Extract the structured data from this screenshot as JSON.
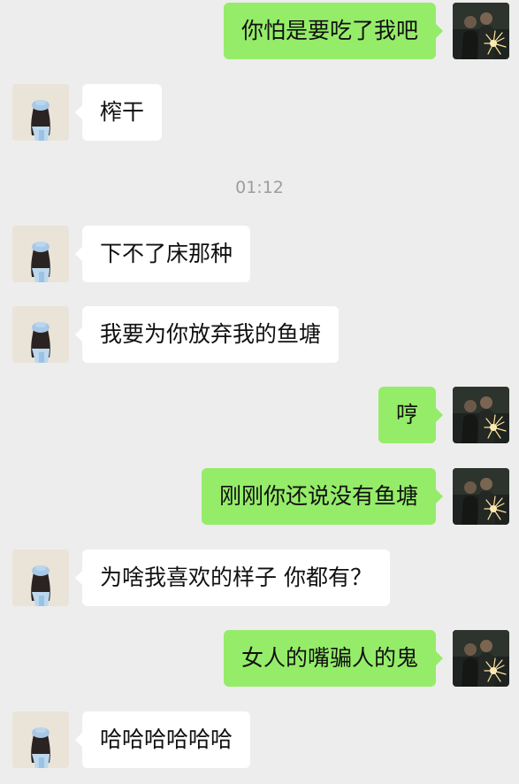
{
  "chat": {
    "timestamp": "01:12",
    "messages": [
      {
        "sender": "me",
        "text": "你怕是要吃了我吧"
      },
      {
        "sender": "other",
        "text": "榨干"
      },
      {
        "sender": "other",
        "text": "下不了床那种"
      },
      {
        "sender": "other",
        "text": "我要为你放弃我的鱼塘"
      },
      {
        "sender": "me",
        "text": "哼"
      },
      {
        "sender": "me",
        "text": "刚刚你还说没有鱼塘"
      },
      {
        "sender": "other",
        "text": "为啥我喜欢的样子 你都有？"
      },
      {
        "sender": "me",
        "text": "女人的嘴骗人的鬼"
      },
      {
        "sender": "other",
        "text": "哈哈哈哈哈哈"
      }
    ]
  },
  "colors": {
    "background": "#ededed",
    "outgoing_bubble": "#95ec69",
    "incoming_bubble": "#ffffff",
    "timestamp_text": "#9d9d9d"
  },
  "icons": {
    "my_avatar": "photo-avatar-sparkler",
    "other_avatar": "photo-avatar-girl-blue-hat"
  }
}
